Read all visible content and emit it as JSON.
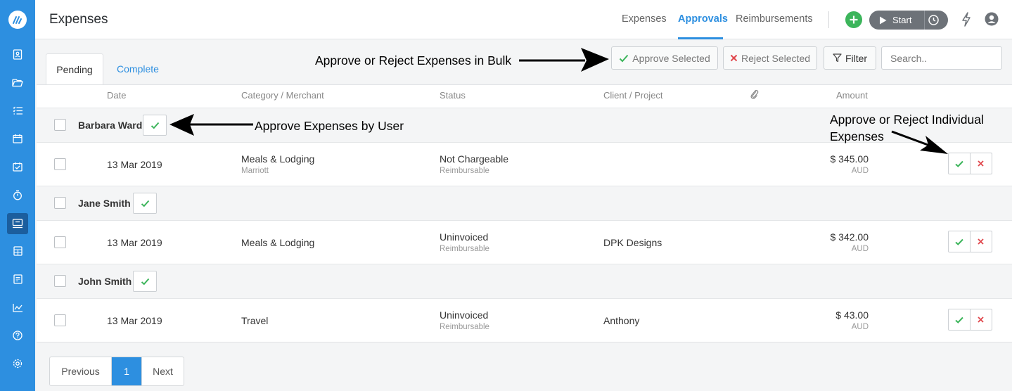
{
  "sidebar": {
    "logo": "app-logo",
    "items": [
      {
        "icon": "contacts-icon"
      },
      {
        "icon": "folder-icon"
      },
      {
        "icon": "tasks-list-icon"
      },
      {
        "icon": "calendar-icon"
      },
      {
        "icon": "calendar-check-icon"
      },
      {
        "icon": "stopwatch-icon"
      },
      {
        "icon": "expenses-icon",
        "active": true
      },
      {
        "icon": "calculator-icon"
      },
      {
        "icon": "invoice-icon"
      },
      {
        "icon": "reports-chart-icon"
      },
      {
        "icon": "help-icon"
      },
      {
        "icon": "settings-gear-icon"
      }
    ]
  },
  "header": {
    "title": "Expenses",
    "nav": [
      "Expenses",
      "Approvals",
      "Reimbursements"
    ],
    "active_nav": "Approvals",
    "start_label": "Start"
  },
  "tabs": {
    "pending": "Pending",
    "complete": "Complete"
  },
  "toolbar": {
    "approve_selected": "Approve Selected",
    "reject_selected": "Reject Selected",
    "filter": "Filter",
    "search_placeholder": "Search.."
  },
  "table": {
    "columns": {
      "date": "Date",
      "category": "Category / Merchant",
      "status": "Status",
      "client": "Client / Project",
      "amount": "Amount"
    },
    "groups": [
      {
        "user": "Barbara Ward",
        "expenses": [
          {
            "date": "13 Mar 2019",
            "category": "Meals & Lodging",
            "merchant": "Marriott",
            "status": "Not Chargeable",
            "status_sub": "Reimbursable",
            "client": "",
            "amount": "$ 345.00",
            "currency": "AUD"
          }
        ]
      },
      {
        "user": "Jane Smith",
        "expenses": [
          {
            "date": "13 Mar 2019",
            "category": "Meals & Lodging",
            "merchant": "",
            "status": "Uninvoiced",
            "status_sub": "Reimbursable",
            "client": "DPK Designs",
            "amount": "$ 342.00",
            "currency": "AUD"
          }
        ]
      },
      {
        "user": "John Smith",
        "expenses": [
          {
            "date": "13 Mar 2019",
            "category": "Travel",
            "merchant": "",
            "status": "Uninvoiced",
            "status_sub": "Reimbursable",
            "client": "Anthony",
            "amount": "$ 43.00",
            "currency": "AUD"
          }
        ]
      }
    ]
  },
  "pagination": {
    "previous": "Previous",
    "current": "1",
    "next": "Next"
  },
  "annotations": {
    "bulk": "Approve or Reject Expenses in Bulk",
    "by_user": "Approve Expenses by User",
    "individual_line1": "Approve or Reject Individual",
    "individual_line2": "Expenses"
  },
  "colors": {
    "brand": "#2d8fe0",
    "approve": "#3cb55b",
    "reject": "#e0474c"
  }
}
